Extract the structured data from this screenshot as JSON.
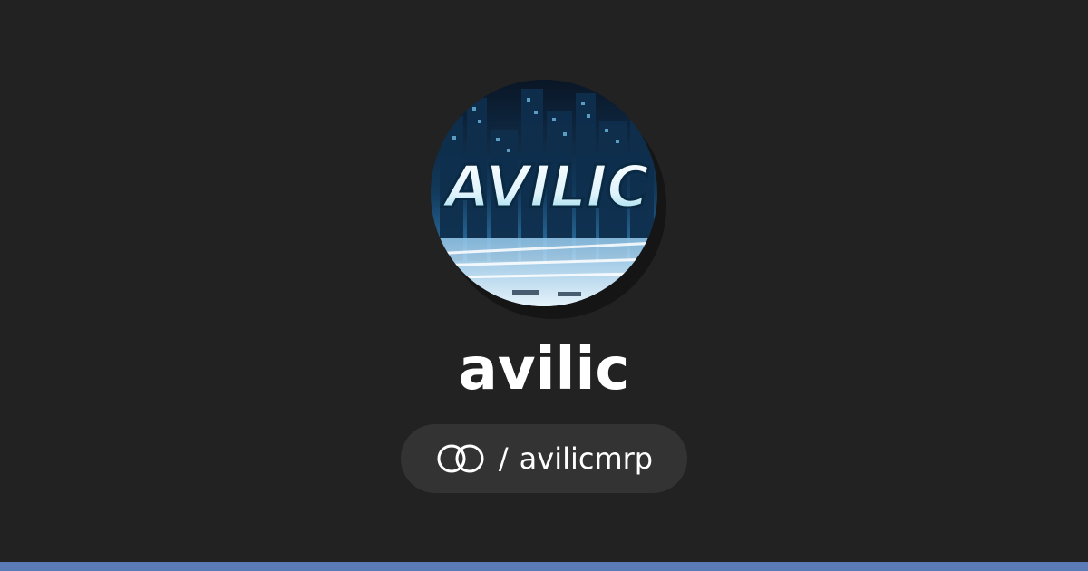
{
  "profile": {
    "name": "avilic",
    "avatar_logo_text": "AVILIC",
    "handle_separator": "/",
    "handle": "avilicmrp",
    "link_icon": "linked-rings-icon"
  },
  "colors": {
    "background": "#222222",
    "pill_background": "#333333",
    "text": "#ffffff",
    "bottom_bar": "#5b7ab8"
  }
}
